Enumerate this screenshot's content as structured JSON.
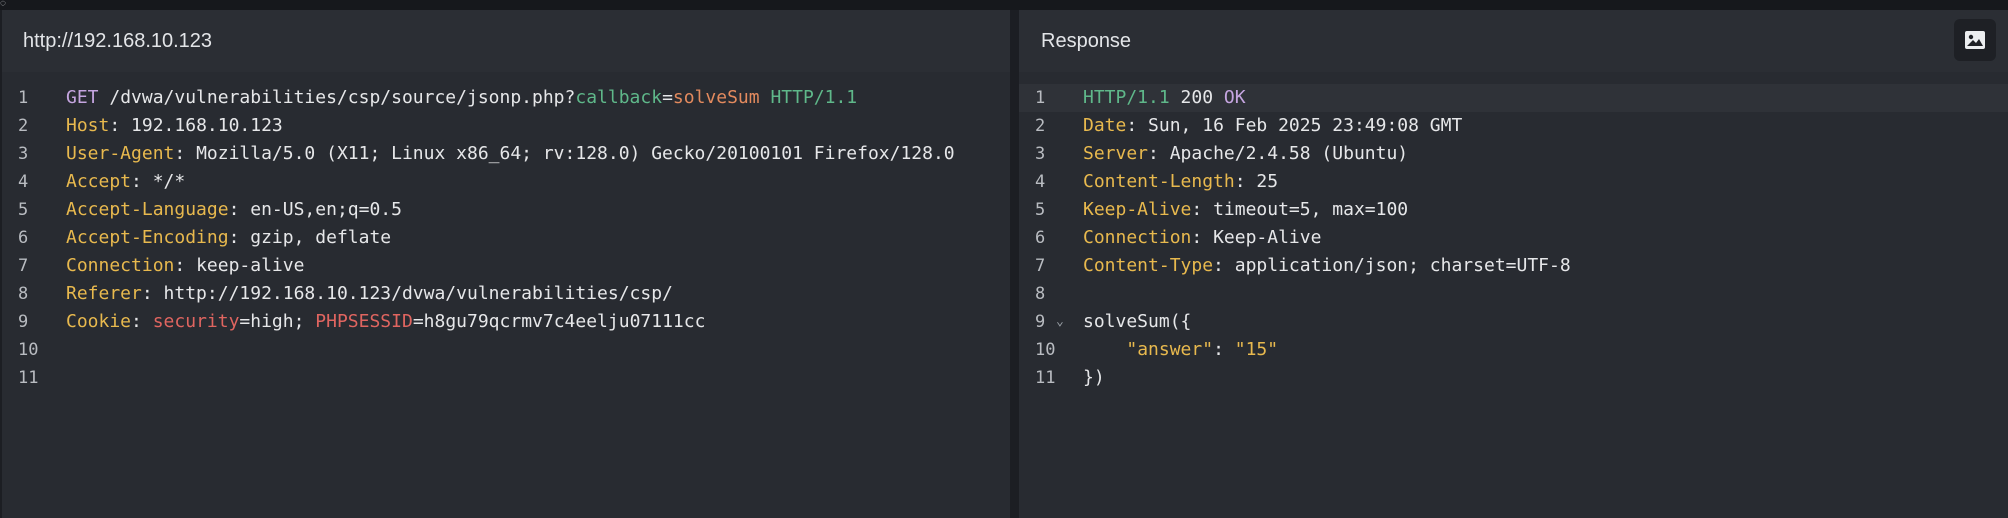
{
  "request": {
    "title": "http://192.168.10.123",
    "lines": [
      {
        "num": "1",
        "method": "GET",
        "path": "/dvwa/vulnerabilities/csp/source/jsonp.php?",
        "param_key": "callback",
        "eq": "=",
        "param_val": "solveSum",
        "protocol": "HTTP/1.1"
      },
      {
        "num": "2",
        "name": "Host",
        "value": "192.168.10.123"
      },
      {
        "num": "3",
        "name": "User-Agent",
        "value": "Mozilla/5.0 (X11; Linux x86_64; rv:128.0) Gecko/20100101 Firefox/128.0"
      },
      {
        "num": "4",
        "name": "Accept",
        "value": "*/*"
      },
      {
        "num": "5",
        "name": "Accept-Language",
        "value": "en-US,en;q=0.5"
      },
      {
        "num": "6",
        "name": "Accept-Encoding",
        "value": "gzip, deflate"
      },
      {
        "num": "7",
        "name": "Connection",
        "value": "keep-alive"
      },
      {
        "num": "8",
        "name": "Referer",
        "value": "http://192.168.10.123/dvwa/vulnerabilities/csp/"
      },
      {
        "num": "9",
        "name": "Cookie",
        "c1_key": "security",
        "c1_val": "=high; ",
        "c2_key": "PHPSESSID",
        "c2_val": "=h8gu79qcrmv7c4eelju07111cc"
      },
      {
        "num": "10"
      },
      {
        "num": "11"
      }
    ]
  },
  "response": {
    "title": "Response",
    "image_button_icon": "image-icon",
    "lines": [
      {
        "num": "1",
        "protocol": "HTTP/1.1",
        "code": "200",
        "status": "OK"
      },
      {
        "num": "2",
        "name": "Date",
        "value": "Sun, 16 Feb 2025 23:49:08 GMT"
      },
      {
        "num": "3",
        "name": "Server",
        "value": "Apache/2.4.58 (Ubuntu)"
      },
      {
        "num": "4",
        "name": "Content-Length",
        "value": "25"
      },
      {
        "num": "5",
        "name": "Keep-Alive",
        "value": "timeout=5, max=100"
      },
      {
        "num": "6",
        "name": "Connection",
        "value": "Keep-Alive"
      },
      {
        "num": "7",
        "name": "Content-Type",
        "value": "application/json; charset=UTF-8"
      },
      {
        "num": "8"
      },
      {
        "num": "9",
        "text": "solveSum({"
      },
      {
        "num": "10",
        "indent": "    ",
        "key": "\"answer\"",
        "colon": ": ",
        "val": "\"15\""
      },
      {
        "num": "11",
        "text": "})"
      }
    ]
  }
}
